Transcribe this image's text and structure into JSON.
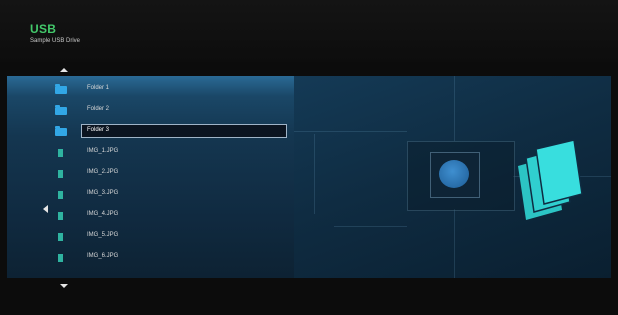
{
  "header": {
    "title": "USB",
    "subtitle": "Sample USB Drive"
  },
  "file_list": {
    "selected_index": 2,
    "items": [
      {
        "label": "Folder 1",
        "icon": "folder-icon"
      },
      {
        "label": "Folder 2",
        "icon": "folder-icon"
      },
      {
        "label": "Folder 3",
        "icon": "folder-icon"
      },
      {
        "label": "IMG_1.JPG",
        "icon": "image-file-icon"
      },
      {
        "label": "IMG_2.JPG",
        "icon": "image-file-icon"
      },
      {
        "label": "IMG_3.JPG",
        "icon": "image-file-icon"
      },
      {
        "label": "IMG_4.JPG",
        "icon": "image-file-icon"
      },
      {
        "label": "IMG_5.JPG",
        "icon": "image-file-icon"
      },
      {
        "label": "IMG_6.JPG",
        "icon": "image-file-icon"
      }
    ]
  },
  "colors": {
    "title": "#43c96b",
    "folder": "#32a7e6",
    "image_file": "#2fb3a0",
    "preview_icon": "#34d3d3"
  }
}
